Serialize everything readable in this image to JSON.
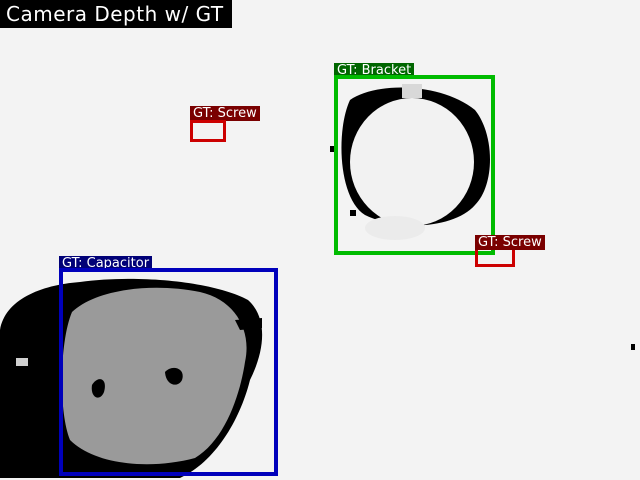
{
  "view_title": "Camera Depth w/ GT",
  "colors": {
    "background": "#f3f3f3",
    "depth_shadow": "#000000",
    "depth_surface": "#9a9a9a",
    "screw": "#cc0000",
    "screw_label_bg": "#7a0000",
    "bracket": "#00bb00",
    "bracket_label_bg": "#006600",
    "capacitor": "#0000bb",
    "capacitor_label_bg": "#000077"
  },
  "annotations": [
    {
      "id": "screw-1",
      "label": "GT: Screw",
      "class": "screw"
    },
    {
      "id": "bracket",
      "label": "GT: Bracket",
      "class": "bracket"
    },
    {
      "id": "screw-2",
      "label": "GT: Screw",
      "class": "screw"
    },
    {
      "id": "capacitor",
      "label": "GT: Capacitor",
      "class": "capacitor"
    }
  ]
}
